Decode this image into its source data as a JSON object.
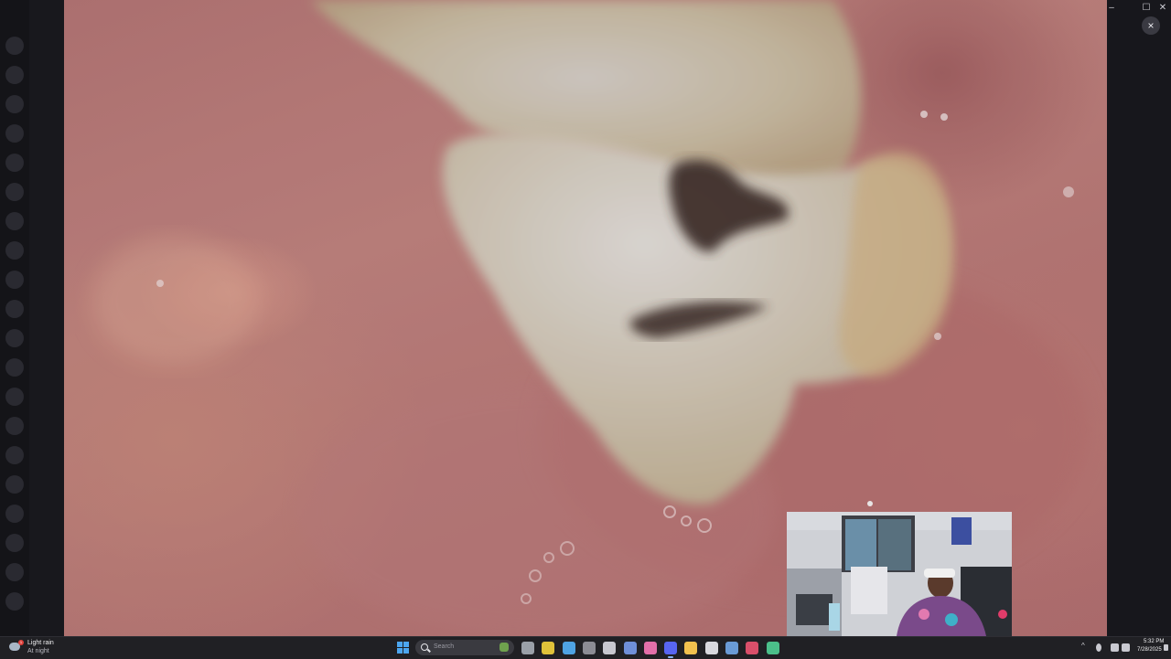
{
  "window": {
    "close_label": "×",
    "minimize_label": "–",
    "maximize_label": "☐",
    "close_window_label": "✕"
  },
  "viewer": {
    "content": "intraoral-dental-photo"
  },
  "webcam": {
    "content": "streamer-webcam"
  },
  "taskbar": {
    "weather": {
      "condition": "Light rain",
      "detail": "At night",
      "badge": "1"
    },
    "search": {
      "placeholder": "Search"
    },
    "apps": [
      {
        "name": "task-view",
        "color": "#9aa0a8"
      },
      {
        "name": "chrome",
        "color": "#e0c23a"
      },
      {
        "name": "chrome-beta",
        "color": "#4fa3e3"
      },
      {
        "name": "media",
        "color": "#8c8c94"
      },
      {
        "name": "calendar",
        "color": "#c7c7cf"
      },
      {
        "name": "notepad",
        "color": "#6f8fd8"
      },
      {
        "name": "photos",
        "color": "#e26fa9"
      },
      {
        "name": "discord",
        "color": "#5865f2"
      },
      {
        "name": "file-explorer",
        "color": "#f2c14e"
      },
      {
        "name": "github",
        "color": "#d8d8de"
      },
      {
        "name": "steam",
        "color": "#6a9bd6"
      },
      {
        "name": "maps",
        "color": "#d94f6a"
      },
      {
        "name": "terminal",
        "color": "#4bbf8a"
      }
    ],
    "tray": {
      "chevron": "^",
      "time": "5:32 PM",
      "date": "7/28/2025"
    }
  }
}
